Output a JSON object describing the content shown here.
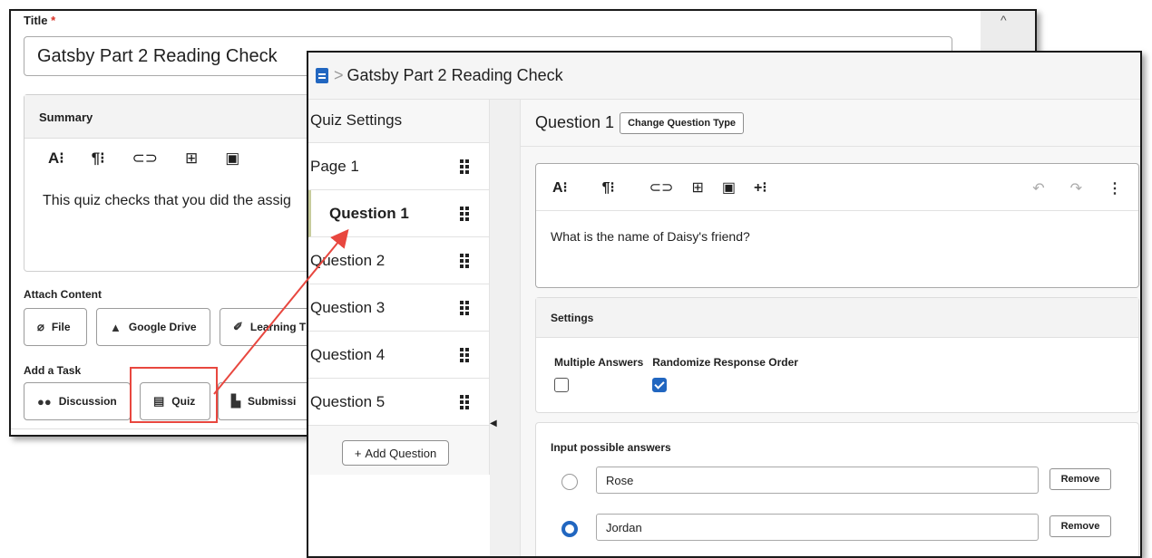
{
  "back": {
    "title_label": "Title",
    "required_mark": "*",
    "title_value": "Gatsby Part 2 Reading Check",
    "summary_label": "Summary",
    "summary_text": "This quiz checks that you did the assig",
    "attach_label": "Attach Content",
    "attach_buttons": [
      "File",
      "Google Drive",
      "Learning T"
    ],
    "task_label": "Add a Task",
    "task_buttons": [
      "Discussion",
      "Quiz",
      "Submissi"
    ]
  },
  "front": {
    "breadcrumb": "Gatsby Part 2 Reading Check",
    "sidebar": {
      "title": "Quiz Settings",
      "items": [
        "Page 1",
        "Question 1",
        "Question 2",
        "Question 3",
        "Question 4",
        "Question 5"
      ],
      "add_button": "Add Question"
    },
    "question": {
      "title": "Question 1",
      "change_type_label": "Change Question Type",
      "prompt": "What is the name of Daisy's friend?"
    },
    "settings": {
      "heading": "Settings",
      "multiple_answers": "Multiple Answers",
      "randomize": "Randomize Response Order",
      "multiple_answers_checked": false,
      "randomize_checked": true
    },
    "answers": {
      "heading": "Input possible answers",
      "items": [
        {
          "value": "Rose",
          "selected": false
        },
        {
          "value": "Jordan",
          "selected": true
        }
      ],
      "remove_label": "Remove"
    }
  },
  "colors": {
    "accent": "#2166c0",
    "highlight": "#e8473f"
  }
}
